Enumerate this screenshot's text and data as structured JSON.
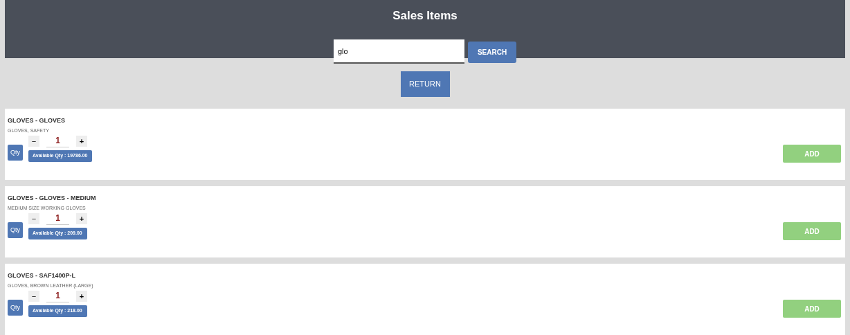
{
  "header": {
    "title": "Sales Items"
  },
  "search": {
    "value": "glo",
    "button": "SEARCH"
  },
  "return_button": "RETURN",
  "items": [
    {
      "name": "GLOVES - GLOVES",
      "description": "GLOVES, SAFETY",
      "qty_label": "Qty",
      "quantity": "1",
      "minus": "−",
      "plus": "+",
      "available": "Available Qty : 19786.00",
      "add": "ADD"
    },
    {
      "name": "GLOVES - GLOVES - MEDIUM",
      "description": "MEDIUM SIZE WORKING GLOVES",
      "qty_label": "Qty",
      "quantity": "1",
      "minus": "−",
      "plus": "+",
      "available": "Available Qty : 209.00",
      "add": "ADD"
    },
    {
      "name": "GLOVES - SAF1400P-L",
      "description": "GLOVES, BROWN LEATHER (LARGE)",
      "qty_label": "Qty",
      "quantity": "1",
      "minus": "−",
      "plus": "+",
      "available": "Available Qty : 218.00",
      "add": "ADD"
    }
  ]
}
